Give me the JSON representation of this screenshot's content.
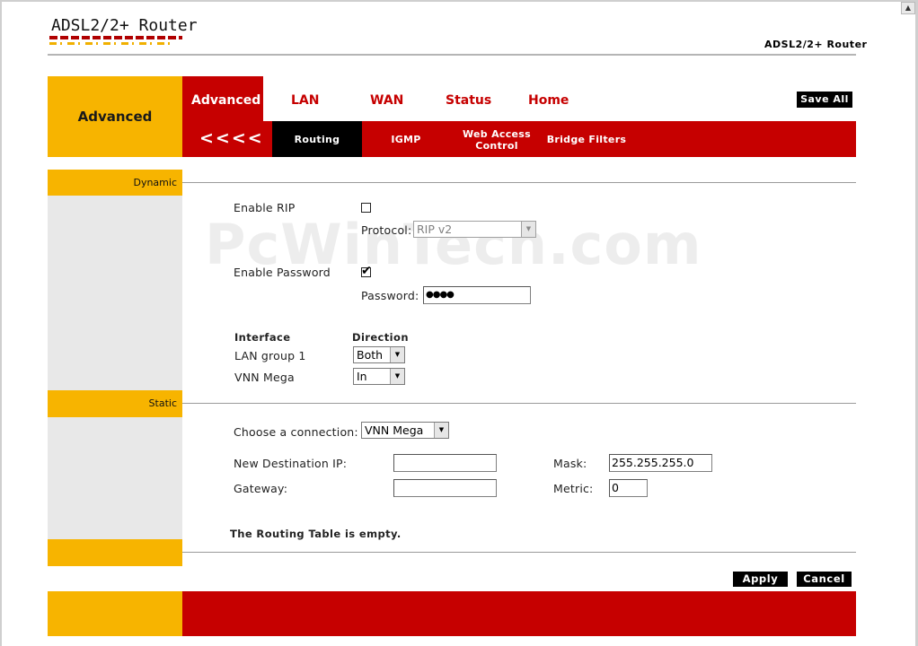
{
  "header": {
    "logo_text": "ADSL2/2+ Router",
    "product_name": "ADSL2/2+ Router"
  },
  "nav": {
    "section_title": "Advanced",
    "tabs": [
      "Advanced",
      "LAN",
      "WAN",
      "Status",
      "Home"
    ],
    "save_all_label": "Save All"
  },
  "subnav": {
    "back_label": "<<<<",
    "items": [
      "Routing",
      "IGMP",
      "Web Access Control",
      "Bridge Filters"
    ]
  },
  "watermark": "PcWinTech.com",
  "dynamic": {
    "section_label": "Dynamic",
    "enable_rip_label": "Enable RIP",
    "enable_rip_checked": false,
    "protocol_label": "Protocol:",
    "protocol_value": "RIP v2",
    "enable_password_label": "Enable Password",
    "enable_password_checked": true,
    "password_label": "Password:",
    "password_value": "●●●●",
    "interface_header": "Interface",
    "direction_header": "Direction",
    "interfaces": [
      {
        "name": "LAN group 1",
        "direction": "Both"
      },
      {
        "name": "VNN Mega",
        "direction": "In"
      }
    ]
  },
  "static": {
    "section_label": "Static",
    "connection_label": "Choose a connection:",
    "connection_value": "VNN Mega",
    "dest_ip_label": "New Destination IP:",
    "dest_ip_value": "",
    "mask_label": "Mask:",
    "mask_value": "255.255.255.0",
    "gateway_label": "Gateway:",
    "gateway_value": "",
    "metric_label": "Metric:",
    "metric_value": "0",
    "routing_table_message": "The Routing Table is empty."
  },
  "actions": {
    "apply_label": "Apply",
    "cancel_label": "Cancel"
  },
  "colors": {
    "brand_red": "#c60000",
    "brand_yellow": "#f7b400",
    "sidebar_gray": "#e8e8e8"
  }
}
